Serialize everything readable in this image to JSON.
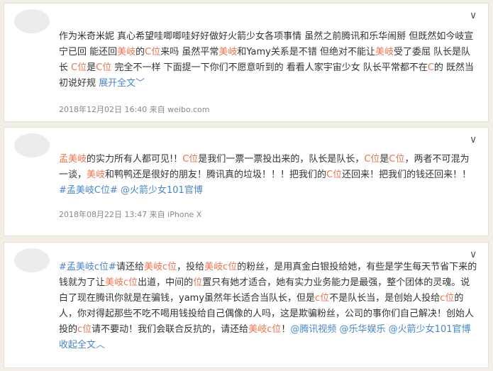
{
  "posts": [
    {
      "segments": [
        {
          "t": "作为米奇米妮 真心希望哇唧唧哇好好做好火箭少女各项事情 虽然之前腾讯和乐华闹掰 但既然如今岐宣宁已回 能还回",
          "c": "n"
        },
        {
          "t": "美岐",
          "c": "h"
        },
        {
          "t": "的",
          "c": "n"
        },
        {
          "t": "C位",
          "c": "h"
        },
        {
          "t": "来吗 虽然平常",
          "c": "n"
        },
        {
          "t": "美岐",
          "c": "h"
        },
        {
          "t": "和Yamy关系是不错 但绝对不能让",
          "c": "n"
        },
        {
          "t": "美岐",
          "c": "h"
        },
        {
          "t": "受了委屈 队长是队长 ",
          "c": "n"
        },
        {
          "t": "C位",
          "c": "h"
        },
        {
          "t": "是",
          "c": "n"
        },
        {
          "t": "C位",
          "c": "h"
        },
        {
          "t": " 完全不一样 下面提一下你们不愿意听到的 看看人家宇宙少女 队长平常都不在",
          "c": "n"
        },
        {
          "t": "C",
          "c": "h"
        },
        {
          "t": "的 既然当初说好规 ",
          "c": "n"
        },
        {
          "t": "展开全文",
          "c": "l"
        },
        {
          "t": "﹀",
          "c": "l"
        }
      ],
      "meta": "2018年12月02日 16:40 来自 weibo.com"
    },
    {
      "segments": [
        {
          "t": "孟美岐",
          "c": "h"
        },
        {
          "t": "的实力所有人都可见!！",
          "c": "n"
        },
        {
          "t": "C位",
          "c": "h"
        },
        {
          "t": "是我们一票一票投出来的，队长是队长，",
          "c": "n"
        },
        {
          "t": "C位",
          "c": "h"
        },
        {
          "t": "是",
          "c": "n"
        },
        {
          "t": "C位",
          "c": "h"
        },
        {
          "t": "，两者不可混为一谈，",
          "c": "n"
        },
        {
          "t": "美岐",
          "c": "h"
        },
        {
          "t": "和鸭鸭还是很好的朋友！腾讯真的垃圾！！！把我们的",
          "c": "n"
        },
        {
          "t": "C位",
          "c": "h"
        },
        {
          "t": "还回来！把我们的钱还回来！！",
          "c": "n"
        },
        {
          "t": "#孟美岐C位#",
          "c": "l"
        },
        {
          "t": " ",
          "c": "n"
        },
        {
          "t": "@火箭少女101官博",
          "c": "l"
        }
      ],
      "meta": "2018年08月22日 13:47 来自 iPhone X"
    },
    {
      "segments": [
        {
          "t": "#孟美岐c位#",
          "c": "l"
        },
        {
          "t": "请还给",
          "c": "n"
        },
        {
          "t": "美岐c位",
          "c": "h"
        },
        {
          "t": "，投给",
          "c": "n"
        },
        {
          "t": "美岐c位",
          "c": "h"
        },
        {
          "t": "的粉丝，是用真金白银投给她，有些是学生每天节省下来的钱就为了让",
          "c": "n"
        },
        {
          "t": "美岐c位",
          "c": "h"
        },
        {
          "t": "出道，中间的",
          "c": "n"
        },
        {
          "t": "位",
          "c": "h"
        },
        {
          "t": "置只有她才适合，她有实力业务能力是最强，整个团体的灵魂。说白了现在腾讯你就是在骗钱，yamy虽然年长适合当队长，但是",
          "c": "n"
        },
        {
          "t": "c位",
          "c": "h"
        },
        {
          "t": "不是队长当，是创始人投给",
          "c": "n"
        },
        {
          "t": "c位",
          "c": "h"
        },
        {
          "t": "的人，你对得起那些不吃不喝用钱投给自己偶像的人吗，这是欺骗粉丝，公司的事你们自己解决！创始人投的",
          "c": "n"
        },
        {
          "t": "c位",
          "c": "h"
        },
        {
          "t": "请不要动！我们会联合反抗的，请还给",
          "c": "n"
        },
        {
          "t": "美岐c位",
          "c": "h"
        },
        {
          "t": "！",
          "c": "n"
        },
        {
          "t": "@腾讯视频",
          "c": "l"
        },
        {
          "t": " ",
          "c": "n"
        },
        {
          "t": "@乐华娱乐",
          "c": "l"
        },
        {
          "t": " ",
          "c": "n"
        },
        {
          "t": "@火箭少女101官博",
          "c": "l"
        },
        {
          "t": " ",
          "c": "n"
        },
        {
          "t": "收起全文",
          "c": "l"
        },
        {
          "t": "︿",
          "c": "l"
        }
      ],
      "meta": ""
    }
  ],
  "icons": {
    "chevron": "chevron-down-icon",
    "chevron_glyph": "∨"
  },
  "colors": {
    "highlight": "#eb7350",
    "link": "#4a86c7",
    "background": "#f4efe6"
  }
}
